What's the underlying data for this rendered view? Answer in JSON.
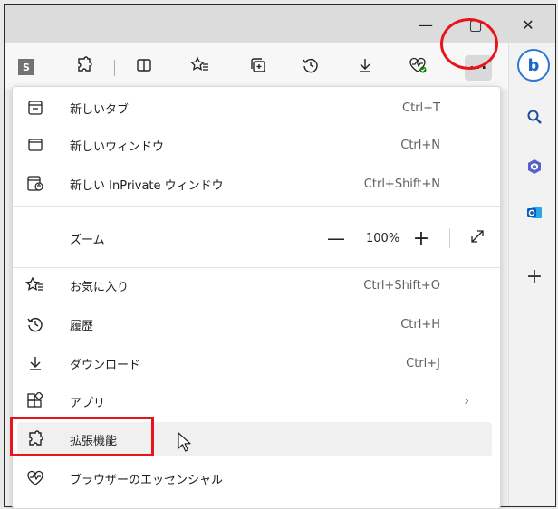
{
  "window": {
    "minimize_glyph": "—",
    "restore_glyph": "▢",
    "close_glyph": "✕"
  },
  "toolbar": {
    "profile_badge": "S",
    "icons": [
      "extensions-icon",
      "split-screen-icon",
      "favorites-icon",
      "collections-icon",
      "history-icon",
      "downloads-icon",
      "browser-essentials-icon"
    ],
    "more_label": "···",
    "highlight_color": "#e8141b"
  },
  "sidebar": {
    "bing_label": "b",
    "add_label": "+",
    "icons": [
      "search-icon",
      "office-icon",
      "outlook-icon"
    ]
  },
  "menu": {
    "new_tab": {
      "label": "新しいタブ",
      "shortcut": "Ctrl+T"
    },
    "new_window": {
      "label": "新しいウィンドウ",
      "shortcut": "Ctrl+N"
    },
    "new_inprivate": {
      "label": "新しい InPrivate ウィンドウ",
      "shortcut": "Ctrl+Shift+N"
    },
    "zoom": {
      "label": "ズーム",
      "minus": "—",
      "value": "100%",
      "plus": "+"
    },
    "favorites": {
      "label": "お気に入り",
      "shortcut": "Ctrl+Shift+O"
    },
    "history": {
      "label": "履歴",
      "shortcut": "Ctrl+H"
    },
    "downloads": {
      "label": "ダウンロード",
      "shortcut": "Ctrl+J"
    },
    "apps": {
      "label": "アプリ",
      "chevron": "›"
    },
    "extensions": {
      "label": "拡張機能"
    },
    "essentials": {
      "label": "ブラウザーのエッセンシャル"
    }
  }
}
